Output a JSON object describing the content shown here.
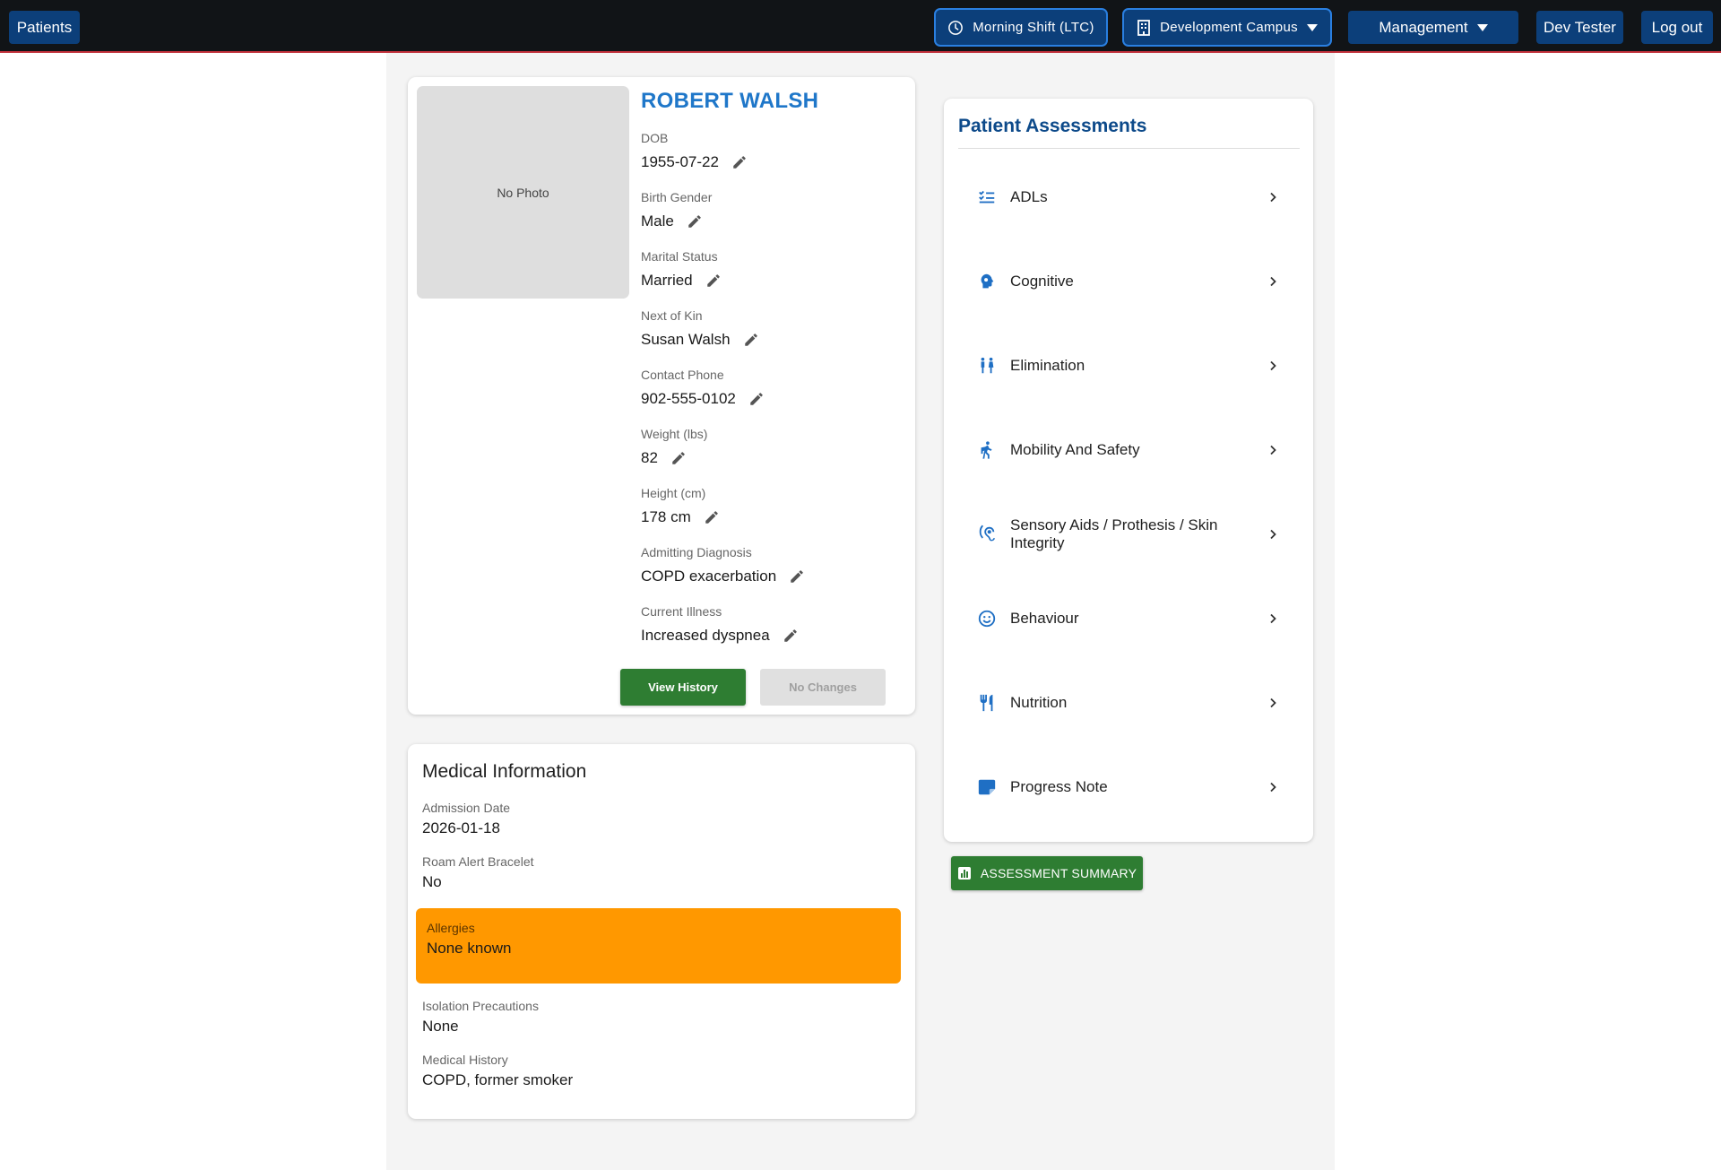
{
  "topbar": {
    "patients_label": "Patients",
    "shift_label": "Morning Shift (LTC)",
    "campus_label": "Development Campus",
    "management_label": "Management",
    "user_label": "Dev Tester",
    "logout_label": "Log out"
  },
  "patient": {
    "photo_placeholder": "No Photo",
    "name": "ROBERT WALSH",
    "fields": [
      {
        "label": "DOB",
        "value": "1955-07-22"
      },
      {
        "label": "Birth Gender",
        "value": "Male"
      },
      {
        "label": "Marital Status",
        "value": "Married"
      },
      {
        "label": "Next of Kin",
        "value": "Susan Walsh"
      },
      {
        "label": "Contact Phone",
        "value": "902-555-0102"
      },
      {
        "label": "Weight (lbs)",
        "value": "82"
      },
      {
        "label": "Height (cm)",
        "value": "178 cm"
      },
      {
        "label": "Admitting Diagnosis",
        "value": "COPD exacerbation"
      },
      {
        "label": "Current Illness",
        "value": "Increased dyspnea"
      }
    ],
    "view_history_label": "View History",
    "no_changes_label": "No Changes"
  },
  "medical": {
    "title": "Medical Information",
    "admission_date": {
      "label": "Admission Date",
      "value": "2026-01-18"
    },
    "roam_alert": {
      "label": "Roam Alert Bracelet",
      "value": "No"
    },
    "allergies": {
      "label": "Allergies",
      "value": "None known"
    },
    "isolation": {
      "label": "Isolation Precautions",
      "value": "None"
    },
    "history": {
      "label": "Medical History",
      "value": "COPD, former smoker"
    }
  },
  "assessments": {
    "title": "Patient Assessments",
    "items": [
      {
        "label": "ADLs",
        "icon": "checklist-icon"
      },
      {
        "label": "Cognitive",
        "icon": "brain-icon"
      },
      {
        "label": "Elimination",
        "icon": "restroom-icon"
      },
      {
        "label": "Mobility And Safety",
        "icon": "walking-icon"
      },
      {
        "label": "Sensory Aids / Prothesis / Skin Integrity",
        "icon": "hearing-icon"
      },
      {
        "label": "Behaviour",
        "icon": "smiley-icon"
      },
      {
        "label": "Nutrition",
        "icon": "utensils-icon"
      },
      {
        "label": "Progress Note",
        "icon": "note-icon"
      }
    ],
    "summary_label": "ASSESSMENT SUMMARY"
  },
  "colors": {
    "topbar_bg": "#111417",
    "nav_button": "#0c3f7a",
    "accent_blue": "#1f77c9",
    "green": "#2e7d32",
    "allergy_bg": "#ff9800"
  }
}
